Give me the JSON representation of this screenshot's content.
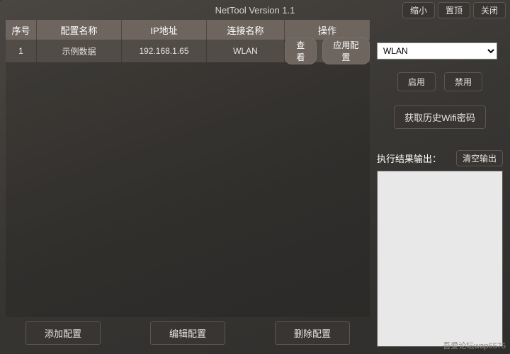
{
  "window": {
    "title": "NetTool Version 1.1",
    "controls": {
      "minimize": "缩小",
      "topmost": "置顶",
      "close": "关闭"
    }
  },
  "table": {
    "headers": {
      "idx": "序号",
      "name": "配置名称",
      "ip": "IP地址",
      "conn": "连接名称",
      "op": "操作"
    },
    "rows": [
      {
        "idx": "1",
        "name": "示例数据",
        "ip": "192.168.1.65",
        "conn": "WLAN",
        "view": "查看",
        "apply": "应用配置"
      }
    ]
  },
  "bottom": {
    "add": "添加配置",
    "edit": "编辑配置",
    "delete": "删除配置"
  },
  "side": {
    "selectValue": "WLAN",
    "enable": "启用",
    "disable": "禁用",
    "wifiHistory": "获取历史Wifi密码",
    "outputLabel": "执行结果输出：",
    "clearOutput": "清空输出"
  },
  "footer": "吾爱论坛wap6575"
}
